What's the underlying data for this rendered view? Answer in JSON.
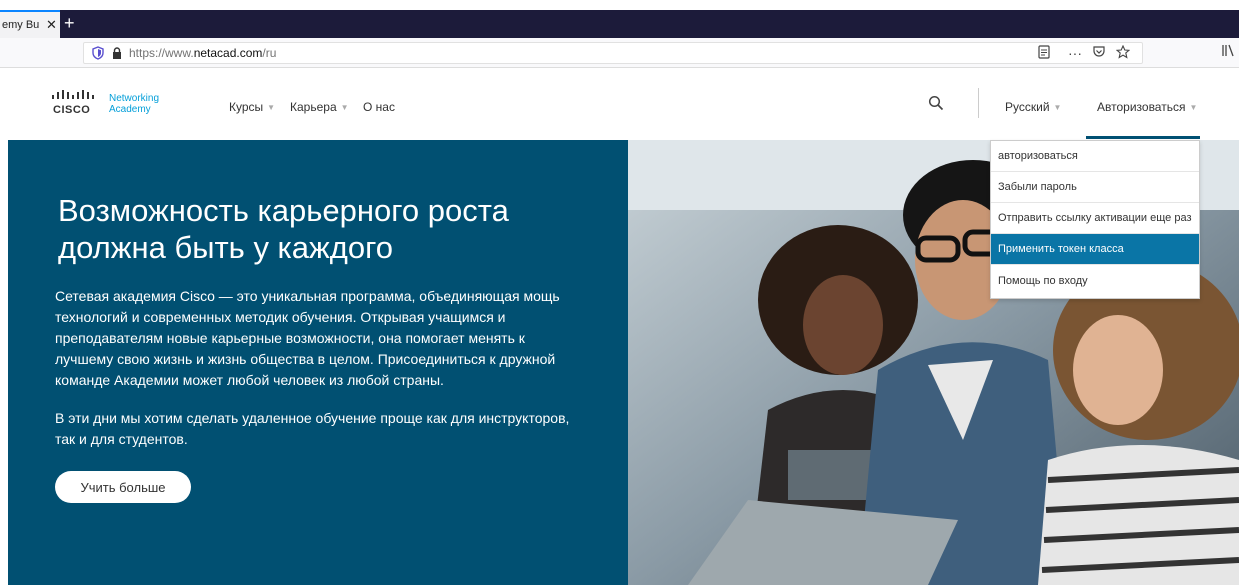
{
  "browser": {
    "tab_title": "emy Bu",
    "tab_close": "✕",
    "new_tab": "+",
    "url_prefix": "https://www.",
    "url_domain": "netacad.com",
    "url_suffix": "/ru",
    "page_actions": "···"
  },
  "header": {
    "logo_cisco": "CISCO",
    "logo_line1": "Networking",
    "logo_line2": "Academy",
    "nav": [
      {
        "label": "Курсы"
      },
      {
        "label": "Карьера"
      },
      {
        "label": "О нас"
      }
    ],
    "language": "Русский",
    "login": "Авторизоваться"
  },
  "login_menu": {
    "items": [
      {
        "label": "авторизоваться"
      },
      {
        "label": "Забыли пароль"
      },
      {
        "label": "Отправить ссылку активации еще раз"
      },
      {
        "label": "Применить токен класса"
      },
      {
        "label": "Помощь по входу"
      }
    ],
    "active_index": 3
  },
  "hero": {
    "title": "Возможность карьерного роста должна быть у каждого",
    "paragraph1": "Сетевая академия Cisco — это уникальная программа, объединяющая мощь технологий и современных методик обучения. Открывая учащимся и преподавателям новые карьерные возможности, она помогает менять к лучшему свою жизнь и жизнь общества в целом. Присоединиться к дружной команде Академии может любой человек из любой страны.",
    "paragraph2": "В эти дни мы хотим сделать удаленное обучение проще как для инструкторов, так и для студентов.",
    "button": "Учить больше"
  },
  "colors": {
    "hero_bg": "#015072",
    "active_item": "#0a75a6",
    "cisco_blue": "#049fd9",
    "tabbar": "#1c1b3a"
  }
}
